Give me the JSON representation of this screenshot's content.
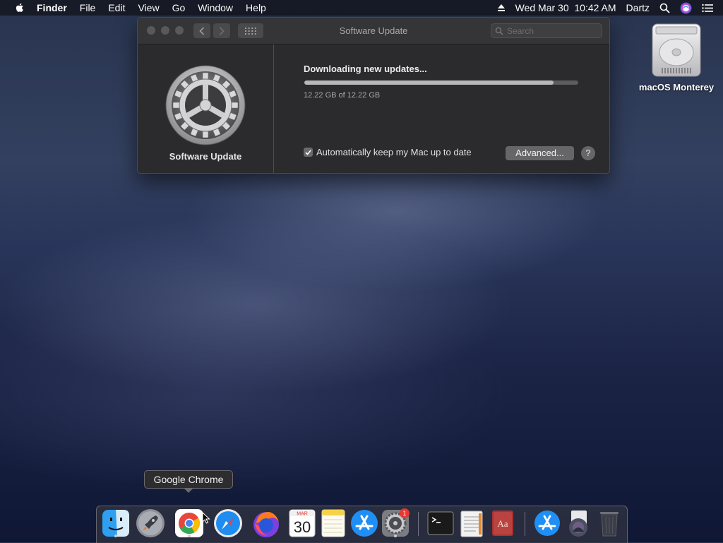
{
  "menubar": {
    "apple_icon": "apple-icon",
    "items": [
      "Finder",
      "File",
      "Edit",
      "View",
      "Go",
      "Window",
      "Help"
    ],
    "clock": "Wed Mar 30  10:42 AM",
    "user": "Dartz",
    "status_icons": [
      "eject-icon",
      "spotlight-search-icon",
      "siri-icon",
      "control-menu-icon"
    ]
  },
  "desktop": {
    "drive_label": "macOS Monterey"
  },
  "window": {
    "title": "Software Update",
    "search_placeholder": "Search",
    "pane_name": "Software Update",
    "status": "Downloading new updates...",
    "progress_fraction": 0.91,
    "size_text": "12.22 GB of 12.22 GB",
    "auto_update_label": "Automatically keep my Mac up to date",
    "auto_update_checked": true,
    "advanced_button": "Advanced...",
    "help_button": "?"
  },
  "tooltip": {
    "text": "Google Chrome"
  },
  "dock": {
    "calendar_month": "MAR",
    "calendar_day": "30",
    "dictionary_text": "Aa",
    "badge_count": "1",
    "apps": [
      "Finder",
      "Launchpad",
      "Google Chrome",
      "Safari",
      "Firefox",
      "Calendar",
      "Notes",
      "App Store",
      "System Preferences",
      "Terminal",
      "TextEdit",
      "Dictionary",
      "Applications",
      "Downloads",
      "Trash"
    ]
  },
  "colors": {
    "window_bg": "#2b2b2d",
    "accent_blue": "#1e8cf0",
    "badge_red": "#e8382f"
  }
}
